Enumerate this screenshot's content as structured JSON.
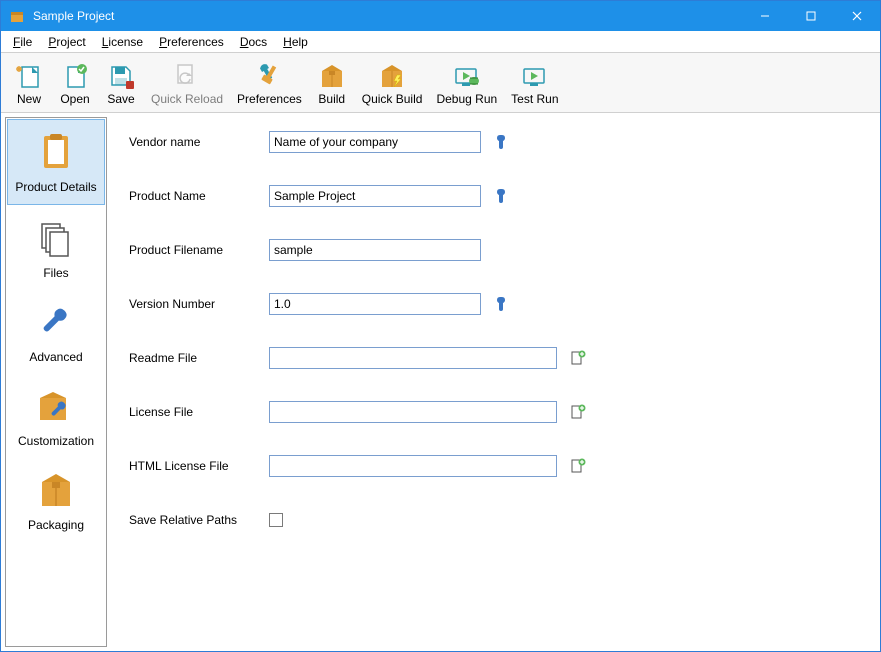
{
  "window": {
    "title": "Sample Project"
  },
  "menu": {
    "file": "File",
    "project": "Project",
    "license": "License",
    "preferences": "Preferences",
    "docs": "Docs",
    "help": "Help"
  },
  "toolbar": {
    "new": "New",
    "open": "Open",
    "save": "Save",
    "quick_reload": "Quick Reload",
    "preferences": "Preferences",
    "build": "Build",
    "quick_build": "Quick Build",
    "debug_run": "Debug Run",
    "test_run": "Test Run"
  },
  "sidebar": {
    "product_details": "Product Details",
    "files": "Files",
    "advanced": "Advanced",
    "customization": "Customization",
    "packaging": "Packaging"
  },
  "form": {
    "vendor_name": {
      "label": "Vendor name",
      "value": "Name of your company"
    },
    "product_name": {
      "label": "Product Name",
      "value": "Sample Project"
    },
    "product_filename": {
      "label": "Product Filename",
      "value": "sample"
    },
    "version_number": {
      "label": "Version Number",
      "value": "1.0"
    },
    "readme_file": {
      "label": "Readme File",
      "value": ""
    },
    "license_file": {
      "label": "License File",
      "value": ""
    },
    "html_license_file": {
      "label": "HTML License File",
      "value": ""
    },
    "save_relative_paths": {
      "label": "Save Relative Paths"
    }
  },
  "colors": {
    "accent": "#1e90e8",
    "box": "#e4a23c",
    "teal": "#2d9ab0",
    "wrench": "#3a76c4"
  }
}
